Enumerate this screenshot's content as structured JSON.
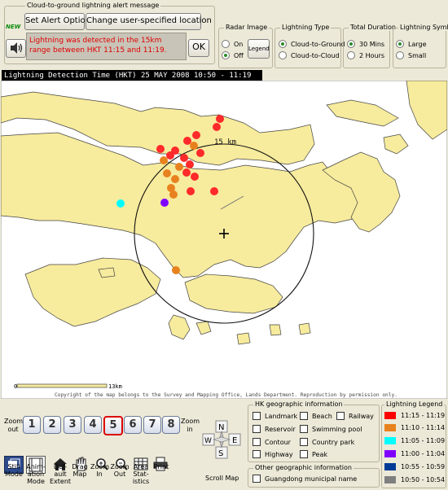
{
  "alert": {
    "group_title": "Cloud-to-ground lightning alert message",
    "new_badge": "NEW",
    "set_alert_label": "Set Alert Option",
    "change_location_label": "Change user-specified location",
    "message": "Lightning was detected in the 15km range between HKT 11:15 and 11:19.",
    "ok_label": "OK"
  },
  "radar": {
    "title": "Radar Image",
    "on": "On",
    "off": "Off",
    "legend_label": "Legend",
    "selected": "Off"
  },
  "lightning_type": {
    "title": "Lightning Type",
    "cg": "Cloud-to-Ground",
    "cc": "Cloud-to-Cloud",
    "selected": "Cloud-to-Ground"
  },
  "duration": {
    "title": "Total Duration",
    "opt1": "30 Mins",
    "opt2": "2 Hours",
    "selected": "30 Mins"
  },
  "symbol": {
    "title": "Lightning Symbol",
    "large": "Large",
    "small": "Small",
    "selected": "Large"
  },
  "map": {
    "header": "Lightning Detection Time (HKT) 25 MAY 2008 10:50 - 11:19",
    "range_label": "15 km",
    "scale_start": "0",
    "scale_end": "13km",
    "copyright": "Copyright of the map belongs to the Survey and Mapping Office, Lands Department. Reproduction by permission only."
  },
  "zoom": {
    "out_label": "Zoom out",
    "in_label": "Zoom in",
    "levels": [
      "1",
      "2",
      "3",
      "4",
      "5",
      "6",
      "7",
      "8"
    ],
    "current": "5"
  },
  "tools": [
    {
      "label": "Still Mode",
      "icon": "still-mode-icon"
    },
    {
      "label": "Anim-ation Mode",
      "icon": "animation-mode-icon"
    },
    {
      "label": "Def-ault Extent",
      "icon": "default-extent-icon"
    },
    {
      "label": "Drag Map",
      "icon": "hand-icon"
    },
    {
      "label": "Zoom In",
      "icon": "zoom-in-icon"
    },
    {
      "label": "Zoom Out",
      "icon": "zoom-out-icon"
    },
    {
      "label": "Area Stat-istics",
      "icon": "statistics-icon"
    },
    {
      "label": "Print",
      "icon": "printer-icon"
    }
  ],
  "scroll": {
    "label": "Scroll Map",
    "n": "N",
    "s": "S",
    "e": "E",
    "w": "W"
  },
  "geo": {
    "title": "HK geographic information",
    "items": [
      "Landmark",
      "Beach",
      "Railway",
      "Reservoir",
      "Swimming pool",
      "Contour",
      "Country park",
      "Highway",
      "Peak"
    ],
    "other_title": "Other geographic information",
    "guangdong": "Guangdong municipal name"
  },
  "lightning_legend": {
    "title": "Lightning Legend",
    "entries": [
      {
        "label": "11:15 - 11:19",
        "color": "#ff0000"
      },
      {
        "label": "11:10 - 11:14",
        "color": "#e8821e"
      },
      {
        "label": "11:05 - 11:09",
        "color": "#00ffff"
      },
      {
        "label": "11:00 - 11:04",
        "color": "#8000ff"
      },
      {
        "label": "10:55 - 10:59",
        "color": "#003c96"
      },
      {
        "label": "10:50 - 10:54",
        "color": "#7f7f7f"
      }
    ]
  }
}
